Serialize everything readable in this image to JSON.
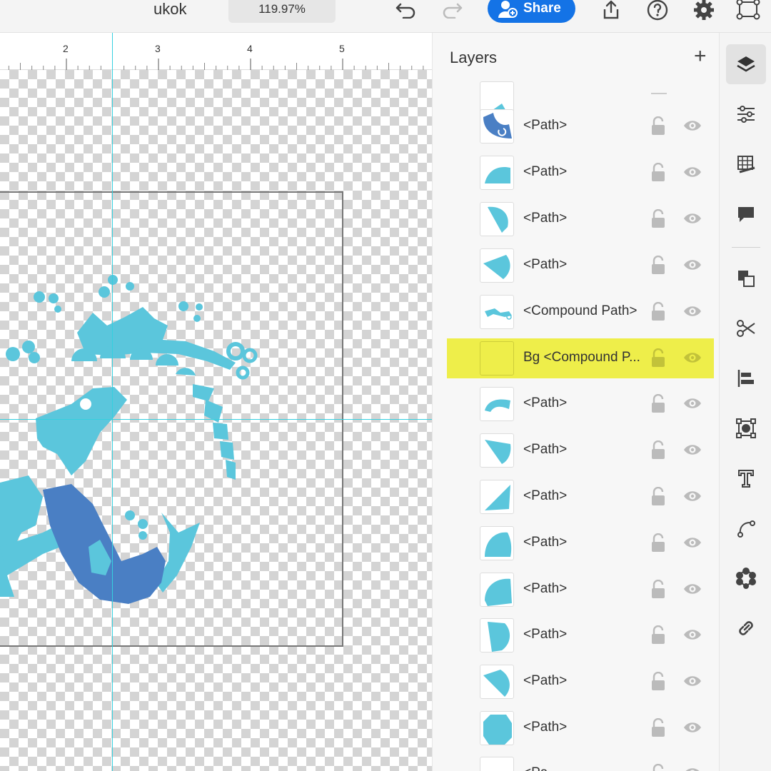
{
  "header": {
    "title": "ukok",
    "zoom": "119.97%",
    "share_label": "Share"
  },
  "ruler": {
    "marks": [
      "2",
      "3",
      "4",
      "5"
    ]
  },
  "layers": {
    "title": "Layers",
    "add_label": "+",
    "items": [
      {
        "name": "",
        "selected": false
      },
      {
        "name": "<Path>",
        "selected": false
      },
      {
        "name": "<Path>",
        "selected": false
      },
      {
        "name": "<Path>",
        "selected": false
      },
      {
        "name": "<Path>",
        "selected": false
      },
      {
        "name": "<Compound Path>",
        "selected": false
      },
      {
        "name": "Bg <Compound P...",
        "selected": true
      },
      {
        "name": "<Path>",
        "selected": false
      },
      {
        "name": "<Path>",
        "selected": false
      },
      {
        "name": "<Path>",
        "selected": false
      },
      {
        "name": "<Path>",
        "selected": false
      },
      {
        "name": "<Path>",
        "selected": false
      },
      {
        "name": "<Path>",
        "selected": false
      },
      {
        "name": "<Path>",
        "selected": false
      },
      {
        "name": "<Path>",
        "selected": false
      },
      {
        "name": "<Pa",
        "selected": false
      }
    ]
  },
  "toolbar_icons": [
    "undo-icon",
    "redo-icon",
    "export-icon",
    "help-icon",
    "settings-icon",
    "artboard-icon"
  ],
  "right_toolbar": [
    "layers-icon",
    "properties-icon",
    "grid-icon",
    "comment-icon",
    "arrange-icon",
    "scissors-icon",
    "align-icon",
    "transform-icon",
    "type-icon",
    "pen-icon",
    "repeat-icon",
    "link-icon"
  ],
  "colors": {
    "accent": "#1473e6",
    "selection": "#eeee4a",
    "art_light": "#5bc6dc",
    "art_dark": "#4a7fc4",
    "guide": "#35d0e0"
  }
}
